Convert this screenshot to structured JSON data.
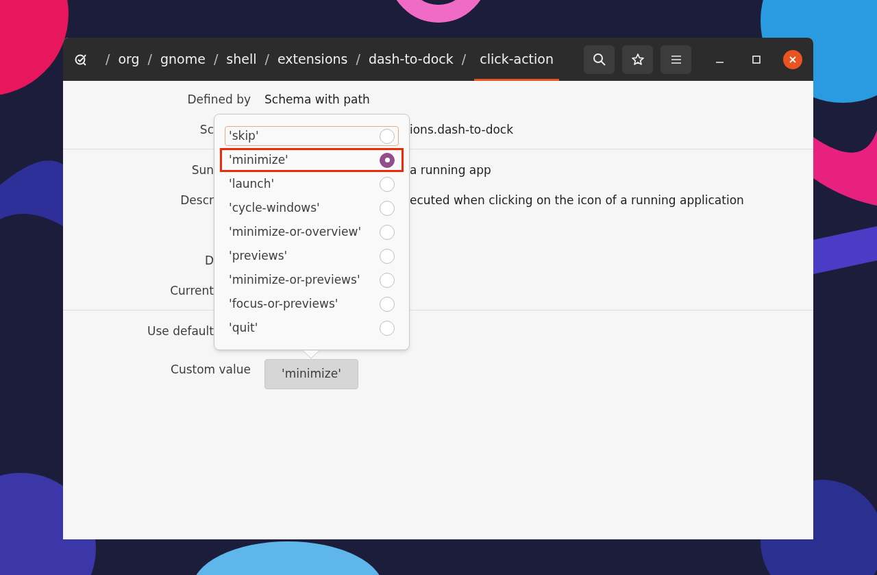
{
  "titlebar": {
    "path": [
      {
        "label": "org",
        "selected": false
      },
      {
        "label": "gnome",
        "selected": false
      },
      {
        "label": "shell",
        "selected": false
      },
      {
        "label": "extensions",
        "selected": false
      },
      {
        "label": "dash-to-dock",
        "selected": false
      },
      {
        "label": "click-action",
        "selected": true
      }
    ],
    "separator": "/"
  },
  "sections": [
    {
      "rows": [
        {
          "kind": "full",
          "label": "Defined by",
          "value": "Schema with path"
        },
        {
          "kind": "covered",
          "label": "Sc",
          "value": "ions.dash-to-dock"
        }
      ]
    },
    {
      "rows": [
        {
          "kind": "covered",
          "label": "Sun",
          "value": "a running app"
        },
        {
          "kind": "covered",
          "label": "Descr",
          "value": "ecuted when clicking on the icon of a running application"
        },
        {
          "kind": "spacer"
        },
        {
          "kind": "covered",
          "label": "D"
        },
        {
          "kind": "covered",
          "label": "Current"
        }
      ]
    },
    {
      "rows": [
        {
          "kind": "covered",
          "label": "Use default"
        },
        {
          "kind": "button",
          "label": "Custom value",
          "value": "'minimize'"
        }
      ]
    }
  ],
  "popover": {
    "options": [
      {
        "label": "'skip'",
        "selected": false,
        "focused": true,
        "annotated": false
      },
      {
        "label": "'minimize'",
        "selected": true,
        "focused": false,
        "annotated": true
      },
      {
        "label": "'launch'",
        "selected": false,
        "focused": false,
        "annotated": false
      },
      {
        "label": "'cycle-windows'",
        "selected": false,
        "focused": false,
        "annotated": false
      },
      {
        "label": "'minimize-or-overview'",
        "selected": false,
        "focused": false,
        "annotated": false
      },
      {
        "label": "'previews'",
        "selected": false,
        "focused": false,
        "annotated": false
      },
      {
        "label": "'minimize-or-previews'",
        "selected": false,
        "focused": false,
        "annotated": false
      },
      {
        "label": "'focus-or-previews'",
        "selected": false,
        "focused": false,
        "annotated": false
      },
      {
        "label": "'quit'",
        "selected": false,
        "focused": false,
        "annotated": false
      }
    ]
  }
}
